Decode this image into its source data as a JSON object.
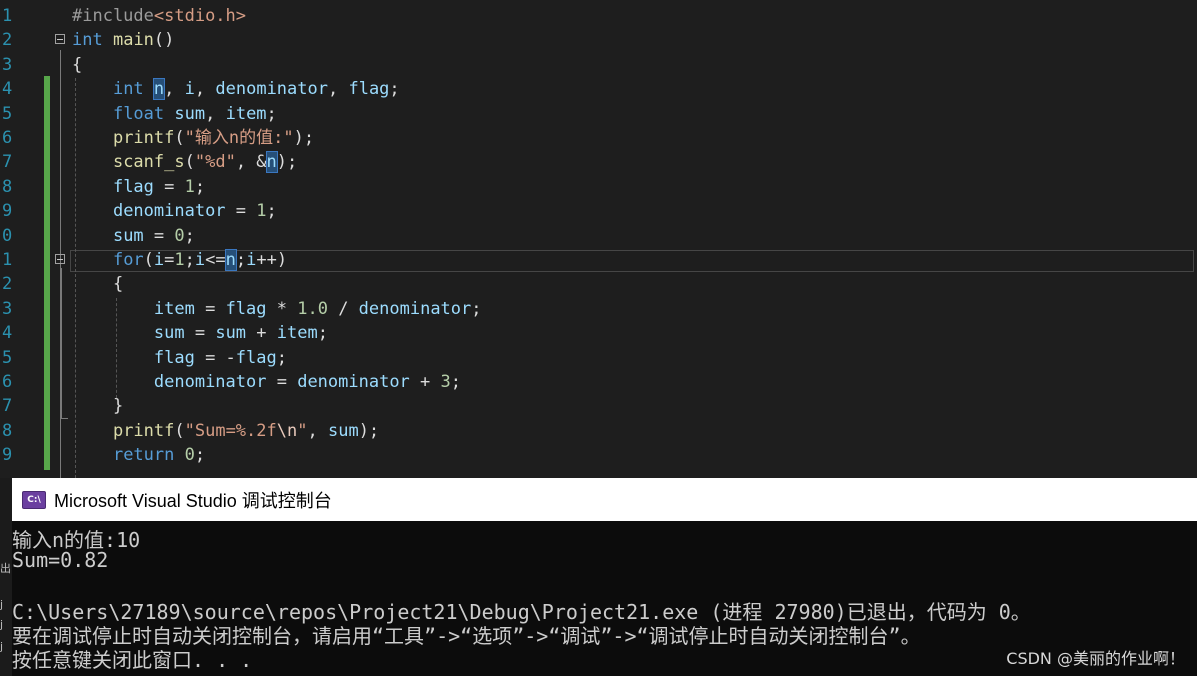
{
  "editor": {
    "lines": [
      {
        "n": "1",
        "html": "<span class=\"pre\">#include</span><span class=\"str\">&lt;stdio.h&gt;</span>"
      },
      {
        "n": "2",
        "html": "<span class=\"kw\">int</span> <span class=\"fn\">main</span>()"
      },
      {
        "n": "3",
        "html": "{"
      },
      {
        "n": "4",
        "html": "    <span class=\"kw\">int</span> <span class=\"var hl\">n</span>, <span class=\"var\">i</span>, <span class=\"var\">denominator</span>, <span class=\"var\">flag</span>;"
      },
      {
        "n": "5",
        "html": "    <span class=\"kw\">float</span> <span class=\"var\">sum</span>, <span class=\"var\">item</span>;"
      },
      {
        "n": "6",
        "html": "    <span class=\"fn\">printf</span>(<span class=\"str\">\"输入n的值:\"</span>);"
      },
      {
        "n": "7",
        "html": "    <span class=\"fn\">scanf_s</span>(<span class=\"str\">\"%d\"</span>, &amp;<span class=\"var hl\">n</span>);"
      },
      {
        "n": "8",
        "html": "    <span class=\"var\">flag</span> = <span class=\"num\">1</span>;"
      },
      {
        "n": "9",
        "html": "    <span class=\"var\">denominator</span> = <span class=\"num\">1</span>;"
      },
      {
        "n": "0",
        "html": "    <span class=\"var\">sum</span> = <span class=\"num\">0</span>;"
      },
      {
        "n": "1",
        "html": "    <span class=\"kw\">for</span>(<span class=\"var\">i</span>=<span class=\"num\">1</span>;<span class=\"var\">i</span>&lt;=<span class=\"var hl\">n</span>;<span class=\"var\">i</span>++)"
      },
      {
        "n": "2",
        "html": "    {"
      },
      {
        "n": "3",
        "html": "        <span class=\"var\">item</span> = <span class=\"var\">flag</span> * <span class=\"num\">1.0</span> / <span class=\"var\">denominator</span>;"
      },
      {
        "n": "4",
        "html": "        <span class=\"var\">sum</span> = <span class=\"var\">sum</span> + <span class=\"var\">item</span>;"
      },
      {
        "n": "5",
        "html": "        <span class=\"var\">flag</span> = -<span class=\"var\">flag</span>;"
      },
      {
        "n": "6",
        "html": "        <span class=\"var\">denominator</span> = <span class=\"var\">denominator</span> + <span class=\"num\">3</span>;"
      },
      {
        "n": "7",
        "html": "    }"
      },
      {
        "n": "8",
        "html": "    <span class=\"fn\">printf</span>(<span class=\"str\">\"Sum=%.2f<span class=\"esc\">\\n</span>\"</span>, <span class=\"var\">sum</span>);"
      },
      {
        "n": "9",
        "html": "    <span class=\"kw\">return</span> <span class=\"num\">0</span>;"
      }
    ]
  },
  "console": {
    "title": "Microsoft Visual Studio 调试控制台",
    "icon_label": "C:\\",
    "icon": "console-app-icon",
    "lines": [
      "输入n的值:10",
      "Sum=0.82",
      "",
      "C:\\Users\\27189\\source\\repos\\Project21\\Debug\\Project21.exe (进程 27980)已退出，代码为 0。",
      "要在调试停止时自动关闭控制台，请启用“工具”->“选项”->“调试”->“调试停止时自动关闭控制台”。",
      "按任意键关闭此窗口. . ."
    ]
  },
  "left_strip_chars": [
    "出",
    "j",
    "j",
    "j"
  ],
  "watermark": "CSDN @美丽的作业啊！",
  "colors": {
    "editor_bg": "#1e1e1e",
    "keyword": "#569cd6",
    "string": "#d69d85",
    "variable": "#9cdcfe",
    "function": "#dcdcaa",
    "number": "#b5cea8",
    "change_bar": "#57a64a",
    "console_bg": "#0c0c0c"
  }
}
